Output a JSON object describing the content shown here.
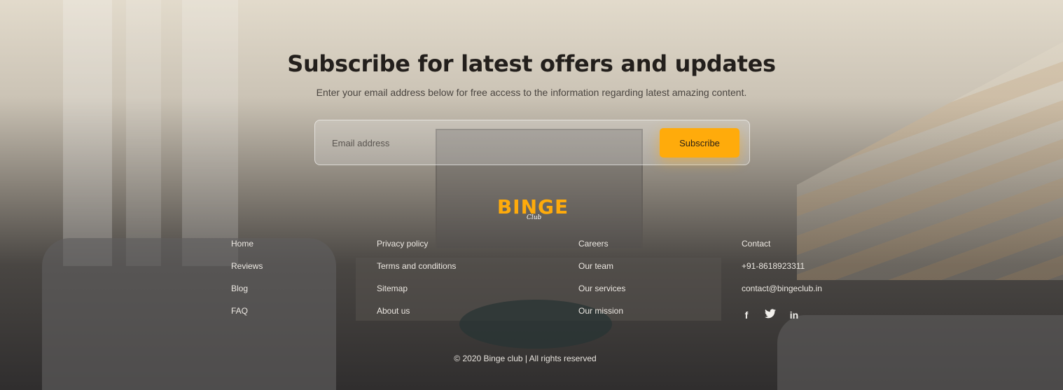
{
  "subscribe": {
    "headline": "Subscribe for latest offers and updates",
    "subtext": "Enter your email address below for free access to the information regarding latest amazing content.",
    "email_placeholder": "Email address",
    "button_label": "Subscribe"
  },
  "brand": {
    "name": "BINGE",
    "sub": "Club",
    "accent_color": "#ffab0b"
  },
  "footer": {
    "col1": [
      "Home",
      "Reviews",
      "Blog",
      "FAQ"
    ],
    "col2": [
      "Privacy policy",
      "Terms and conditions",
      "Sitemap",
      "About us"
    ],
    "col3": [
      "Careers",
      "Our team",
      "Our services",
      "Our mission"
    ],
    "contact": {
      "title": "Contact",
      "phone": "+91-8618923311",
      "email": "contact@bingeclub.in"
    },
    "social_icons": [
      "facebook-icon",
      "twitter-icon",
      "linkedin-icon"
    ],
    "copyright": "© 2020 Binge club | All rights reserved"
  }
}
